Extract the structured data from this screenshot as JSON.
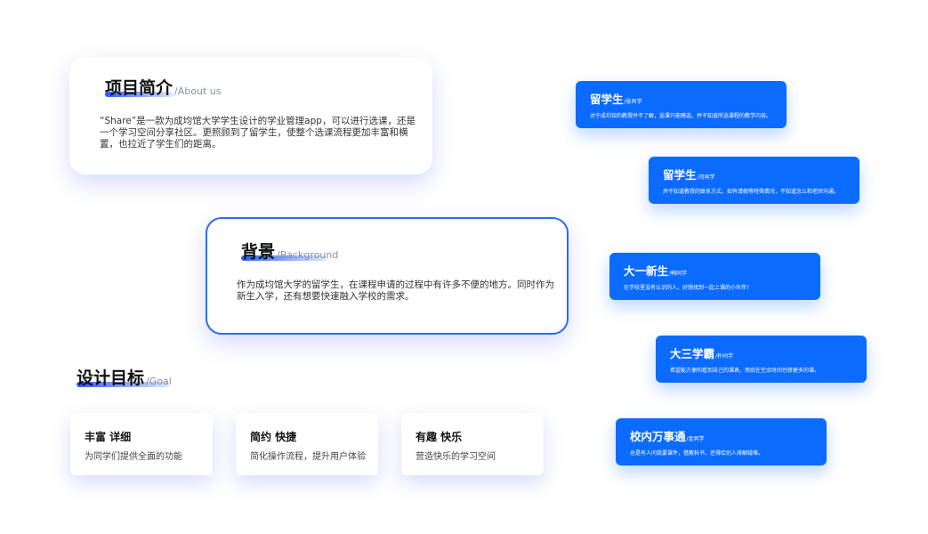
{
  "about": {
    "title": "项目简介",
    "subtitle": "/About us",
    "text": "“Share”是一款为成均馆大学学生设计的学业管理app，可以进行选课，还是一个学习空间分享社区。更照顾到了留学生，使整个选课流程更加丰富和横置，也拉近了学生们的距离。"
  },
  "background": {
    "title": "背景",
    "subtitle": "/Background",
    "text": "作为成均馆大学的留学生，在课程申请的过程中有许多不便的地方。同时作为新生入学，还有想要快速融入学校的需求。"
  },
  "goals": {
    "title": "设计目标",
    "subtitle": "/Goal",
    "items": [
      {
        "title": "丰富 详细",
        "desc": "为同学们提供全面的功能"
      },
      {
        "title": "简约 快捷",
        "desc": "简化操作流程，提升用户体验"
      },
      {
        "title": "有趣 快乐",
        "desc": "营造快乐的学习空间"
      }
    ]
  },
  "personas": [
    {
      "name": "留学生",
      "sub": "/张同学",
      "desc": "对于成均馆的教授并不了解，选课只能瞎选，并不知道所选课程的教学内容。"
    },
    {
      "name": "留学生",
      "sub": "/刘同学",
      "desc": "并不知道教授的联系方式，如有请假等特殊情况，不知道怎么和老师沟通。"
    },
    {
      "name": "大一新生",
      "sub": "/韩同学",
      "desc": "在学校里没有认识的人，好想找到一起上课的小伙伴！"
    },
    {
      "name": "大三学霸",
      "sub": "/朴同学",
      "desc": "希望能方便的看到自己的课表，然后在空余时间也修更多的课。"
    },
    {
      "name": "校内万事通",
      "sub": "/金同学",
      "desc": "总是有人问我要课件，借教科书，还得给别人排解疑难。"
    }
  ],
  "colors": {
    "accent": "#0b6bff",
    "outline": "#2b6cf0"
  }
}
